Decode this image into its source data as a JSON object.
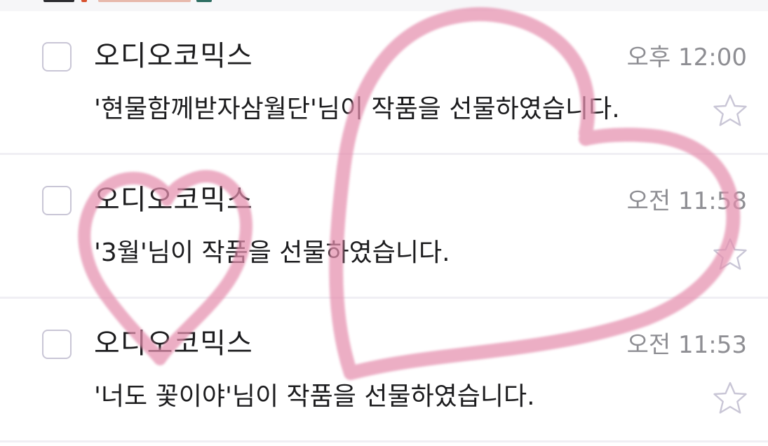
{
  "mail_list": {
    "items": [
      {
        "sender": "오디오코믹스",
        "time": "오후 12:00",
        "message": "'현물함께받자삼월단'님이 작품을 선물하였습니다."
      },
      {
        "sender": "오디오코믹스",
        "time": "오전 11:58",
        "message": "'3월'님이 작품을 선물하였습니다."
      },
      {
        "sender": "오디오코믹스",
        "time": "오전 11:53",
        "message": "'너도 꽃이야'님이 작품을 선물하였습니다."
      }
    ]
  },
  "icons": {
    "checkbox": "checkbox-icon",
    "star": "star-outline-icon",
    "overlay": "heart-doodle"
  },
  "colors": {
    "star_outline": "#c9c6d6",
    "checkbox_border": "#c9c6d6",
    "heart": "#e58fae",
    "time_text": "#8e8e93"
  }
}
